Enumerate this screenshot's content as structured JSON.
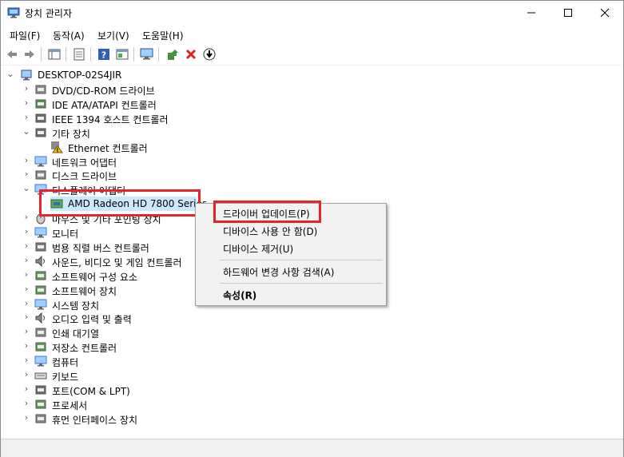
{
  "window": {
    "title": "장치 관리자",
    "controls": {
      "minimize": "—",
      "maximize": "☐",
      "close": "✕"
    }
  },
  "menubar": [
    "파일(F)",
    "동작(A)",
    "보기(V)",
    "도움말(H)"
  ],
  "tree": {
    "root": "DESKTOP-02S4JIR",
    "items": [
      {
        "label": "DVD/CD-ROM 드라이브",
        "icon": "dvd-drive-icon",
        "expanded": false
      },
      {
        "label": "IDE ATA/ATAPI 컨트롤러",
        "icon": "ide-controller-icon",
        "expanded": false
      },
      {
        "label": "IEEE 1394 호스트 컨트롤러",
        "icon": "ieee1394-icon",
        "expanded": false
      },
      {
        "label": "기타 장치",
        "icon": "other-devices-icon",
        "expanded": true
      },
      {
        "label": "Ethernet 컨트롤러",
        "icon": "warning-device-icon",
        "child": true
      },
      {
        "label": "네트워크 어댑터",
        "icon": "network-adapter-icon",
        "expanded": false
      },
      {
        "label": "디스크 드라이브",
        "icon": "disk-drive-icon",
        "expanded": false
      },
      {
        "label": "디스플레이 어댑터",
        "icon": "display-adapter-icon",
        "expanded": true
      },
      {
        "label": "AMD Radeon HD 7800 Series",
        "icon": "display-card-icon",
        "child": true,
        "selected": true
      },
      {
        "label": "마우스 및 기타 포인팅 장치",
        "icon": "mouse-icon",
        "expanded": false
      },
      {
        "label": "모니터",
        "icon": "monitor-icon",
        "expanded": false
      },
      {
        "label": "범용 직렬 버스 컨트롤러",
        "icon": "usb-icon",
        "expanded": false
      },
      {
        "label": "사운드, 비디오 및 게임 컨트롤러",
        "icon": "sound-icon",
        "expanded": false
      },
      {
        "label": "소프트웨어 구성 요소",
        "icon": "software-component-icon",
        "expanded": false
      },
      {
        "label": "소프트웨어 장치",
        "icon": "software-device-icon",
        "expanded": false
      },
      {
        "label": "시스템 장치",
        "icon": "system-device-icon",
        "expanded": false
      },
      {
        "label": "오디오 입력 및 출력",
        "icon": "audio-io-icon",
        "expanded": false
      },
      {
        "label": "인쇄 대기열",
        "icon": "print-queue-icon",
        "expanded": false
      },
      {
        "label": "저장소 컨트롤러",
        "icon": "storage-controller-icon",
        "expanded": false
      },
      {
        "label": "컴퓨터",
        "icon": "computer-icon",
        "expanded": false
      },
      {
        "label": "키보드",
        "icon": "keyboard-icon",
        "expanded": false
      },
      {
        "label": "포트(COM & LPT)",
        "icon": "port-icon",
        "expanded": false
      },
      {
        "label": "프로세서",
        "icon": "processor-icon",
        "expanded": false
      },
      {
        "label": "휴먼 인터페이스 장치",
        "icon": "hid-icon",
        "expanded": false
      }
    ]
  },
  "context_menu": {
    "update_driver": "드라이버 업데이트(P)",
    "disable_device": "디바이스 사용 안 함(D)",
    "uninstall_device": "디바이스 제거(U)",
    "scan_hardware": "하드웨어 변경 사항 검색(A)",
    "properties": "속성(R)"
  },
  "colors": {
    "highlight": "#e4262b",
    "selection": "#cce8ff"
  }
}
